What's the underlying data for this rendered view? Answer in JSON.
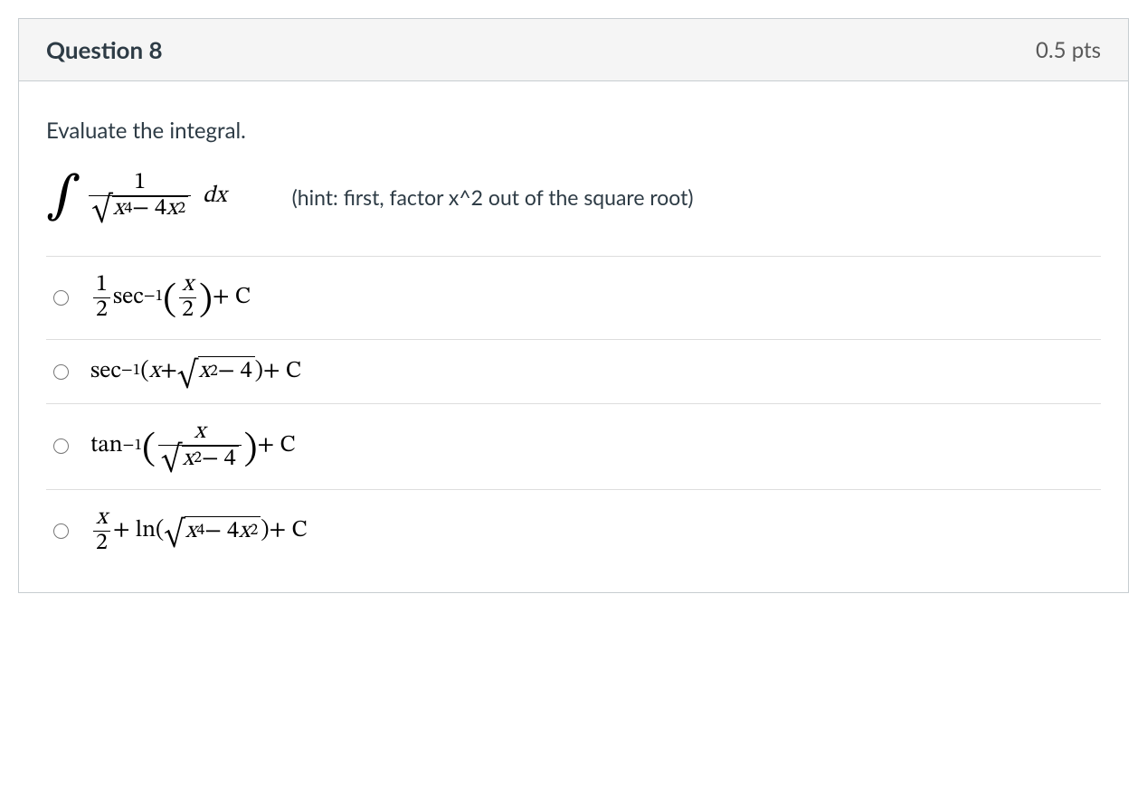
{
  "header": {
    "title": "Question 8",
    "points": "0.5 pts"
  },
  "prompt": "Evaluate the integral.",
  "hint": "(hint: first, factor x^2 out of the square root)",
  "integral": {
    "numerator": "1",
    "rad_a": "x",
    "rad_a_exp": "4",
    "rad_minus": " − 4",
    "rad_b": "x",
    "rad_b_exp": "2",
    "dx": "dx"
  },
  "options": {
    "a": {
      "half_num": "1",
      "half_den": "2",
      "sec": "sec",
      "sec_exp": "−1",
      "inner_num": "x",
      "inner_den": "2",
      "plusC": " + C"
    },
    "b": {
      "sec": "sec",
      "sec_exp": "−1",
      "open": "(",
      "x": "x",
      "plus": " + ",
      "rad_x": "x",
      "rad_exp": "2",
      "rad_tail": " − 4",
      "close": ")",
      "plusC": " + C"
    },
    "c": {
      "tan": "tan",
      "tan_exp": "−1",
      "inner_num": "x",
      "rad_x": "x",
      "rad_exp": "2",
      "rad_tail": " − 4",
      "plusC": " + C"
    },
    "d": {
      "half_num": "x",
      "half_den": "2",
      "plus_ln": " + ln(",
      "rad_x": "x",
      "rad_exp1": "4",
      "rad_mid": " − 4",
      "rad_x2": "x",
      "rad_exp2": "2",
      "close": ")",
      "plusC": " + C"
    }
  }
}
